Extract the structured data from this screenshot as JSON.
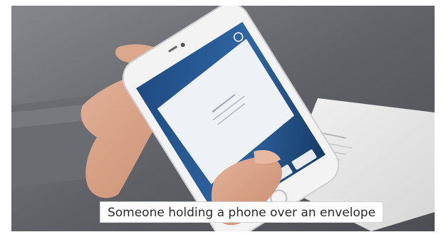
{
  "image": {
    "caption": "Someone holding a phone over an envelope",
    "alt": "Someone holding a phone over an envelope"
  },
  "colors": {
    "background": "#5f6166",
    "phone_body": "#f2f2f2",
    "screen_blue": "#24558f",
    "envelope": "#e9e9e9",
    "skin": "#d7a287"
  },
  "icons": [
    "play-icon",
    "camera-icon",
    "settings-icon"
  ]
}
